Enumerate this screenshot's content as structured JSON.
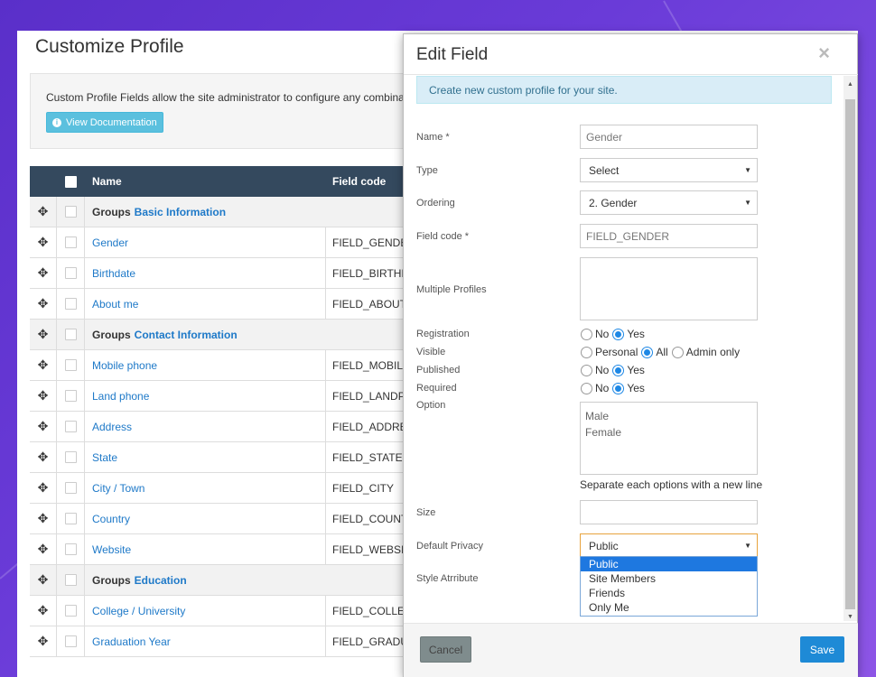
{
  "page": {
    "title": "Customize Profile",
    "info_text": "Custom Profile Fields allow the site administrator to configure any combination",
    "doc_button": "View Documentation",
    "table": {
      "headers": {
        "name": "Name",
        "code": "Field code"
      },
      "rows": [
        {
          "type": "group",
          "prefix": "Groups",
          "name": "Basic Information",
          "code": ""
        },
        {
          "type": "field",
          "name": "Gender",
          "code": "FIELD_GENDER"
        },
        {
          "type": "field",
          "name": "Birthdate",
          "code": "FIELD_BIRTHDATE"
        },
        {
          "type": "field",
          "name": "About me",
          "code": "FIELD_ABOUTME"
        },
        {
          "type": "group",
          "prefix": "Groups",
          "name": "Contact Information",
          "code": ""
        },
        {
          "type": "field",
          "name": "Mobile phone",
          "code": "FIELD_MOBILE"
        },
        {
          "type": "field",
          "name": "Land phone",
          "code": "FIELD_LANDPHONE"
        },
        {
          "type": "field",
          "name": "Address",
          "code": "FIELD_ADDRESS"
        },
        {
          "type": "field",
          "name": "State",
          "code": "FIELD_STATE"
        },
        {
          "type": "field",
          "name": "City / Town",
          "code": "FIELD_CITY"
        },
        {
          "type": "field",
          "name": "Country",
          "code": "FIELD_COUNTRY"
        },
        {
          "type": "field",
          "name": "Website",
          "code": "FIELD_WEBSITE"
        },
        {
          "type": "group",
          "prefix": "Groups",
          "name": "Education",
          "code": ""
        },
        {
          "type": "field",
          "name": "College / University",
          "code": "FIELD_COLLEGE"
        },
        {
          "type": "field",
          "name": "Graduation Year",
          "code": "FIELD_GRADUATION"
        }
      ]
    }
  },
  "modal": {
    "title": "Edit Field",
    "close": "×",
    "alert": "Create new custom profile for your site.",
    "labels": {
      "name": "Name *",
      "type": "Type",
      "ordering": "Ordering",
      "field_code": "Field code *",
      "multiple_profiles": "Multiple Profiles",
      "registration": "Registration",
      "visible": "Visible",
      "published": "Published",
      "required": "Required",
      "option": "Option",
      "size": "Size",
      "default_privacy": "Default Privacy",
      "style_attribute": "Style Atrribute"
    },
    "values": {
      "name": "Gender",
      "type": "Select",
      "ordering": "2. Gender",
      "field_code": "FIELD_GENDER",
      "options_line1": "Male",
      "options_line2": "Female",
      "default_privacy": "Public"
    },
    "radios": {
      "no": "No",
      "yes": "Yes",
      "personal": "Personal",
      "all": "All",
      "admin_only": "Admin only"
    },
    "helper": "Separate each options with a new line",
    "privacy_options": [
      "Public",
      "Site Members",
      "Friends",
      "Only Me"
    ],
    "buttons": {
      "cancel": "Cancel",
      "save": "Save"
    }
  }
}
